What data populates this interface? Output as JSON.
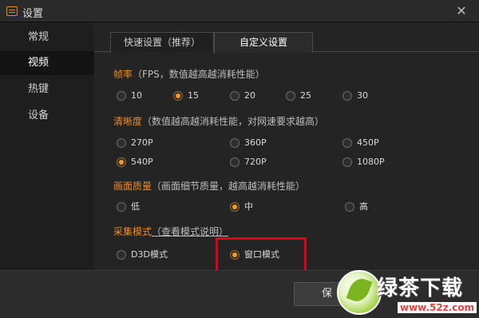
{
  "window": {
    "title": "设置",
    "close_symbol": "✕"
  },
  "sidebar": {
    "items": [
      {
        "label": "常规",
        "active": false
      },
      {
        "label": "视频",
        "active": true
      },
      {
        "label": "热键",
        "active": false
      },
      {
        "label": "设备",
        "active": false
      }
    ]
  },
  "tabs": [
    {
      "label": "快速设置（推荐）",
      "active": false
    },
    {
      "label": "自定义设置",
      "active": true
    }
  ],
  "sections": {
    "fps": {
      "title": "帧率",
      "hint": "（FPS，数值越高越消耗性能）",
      "options": [
        "10",
        "15",
        "20",
        "25",
        "30"
      ],
      "selected": "15"
    },
    "resolution": {
      "title": "清晰度",
      "hint": "（数值越高越消耗性能，对网速要求越高）",
      "options": [
        "270P",
        "360P",
        "450P",
        "540P",
        "720P",
        "1080P"
      ],
      "selected": "540P"
    },
    "quality": {
      "title": "画面质量",
      "hint": "（画面细节质量，越高越消耗性能）",
      "options": [
        "低",
        "中",
        "高"
      ],
      "selected": "中"
    },
    "capture": {
      "title": "采集模式",
      "link": "（查看模式说明）",
      "options": [
        "D3D模式",
        "窗口模式"
      ],
      "selected": "窗口模式"
    }
  },
  "footer": {
    "save_label": "保"
  },
  "watermark": {
    "text": "绿茶下载",
    "url": "www.52z.com"
  },
  "colors": {
    "accent": "#f08a24",
    "highlight": "#e0001b"
  }
}
